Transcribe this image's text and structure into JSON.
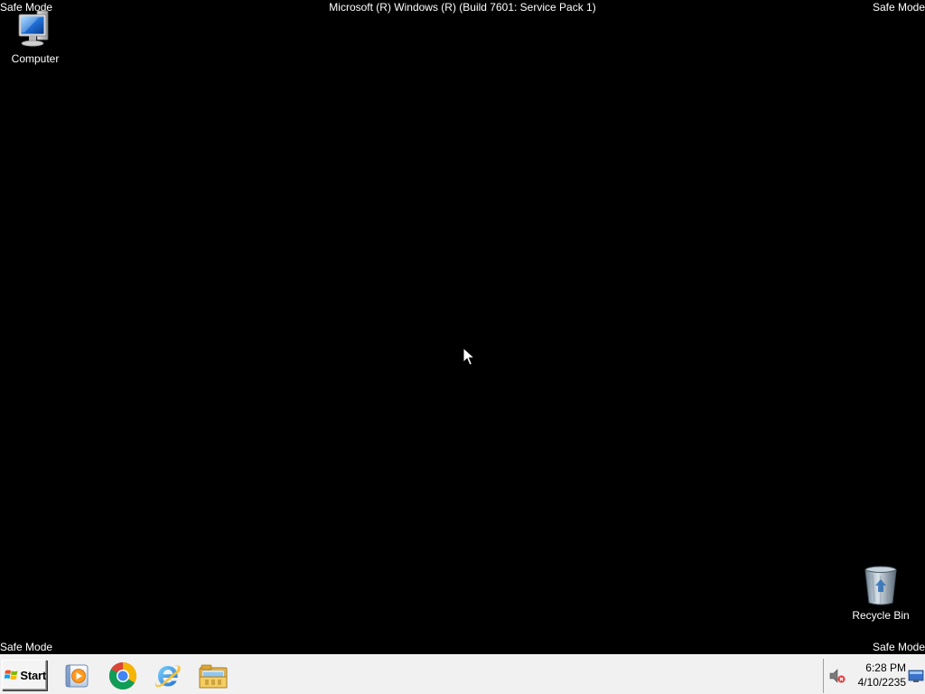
{
  "desktop": {
    "background": "#000000",
    "safe_mode_label": "Safe Mode",
    "build_info": "Microsoft (R) Windows (R) (Build 7601: Service Pack 1)",
    "icons": [
      {
        "name": "computer-icon",
        "label": "Computer"
      },
      {
        "name": "recycle-bin-icon",
        "label": "Recycle Bin"
      }
    ]
  },
  "taskbar": {
    "background": "#f1f1f1",
    "start_label": "Start",
    "pinned_apps": [
      "windows-media-player-icon",
      "chrome-icon",
      "internet-explorer-icon",
      "windows-explorer-icon"
    ],
    "tray": {
      "volume_icon": "volume-muted-icon",
      "time": "6:28 PM",
      "date": "4/10/2235"
    }
  }
}
